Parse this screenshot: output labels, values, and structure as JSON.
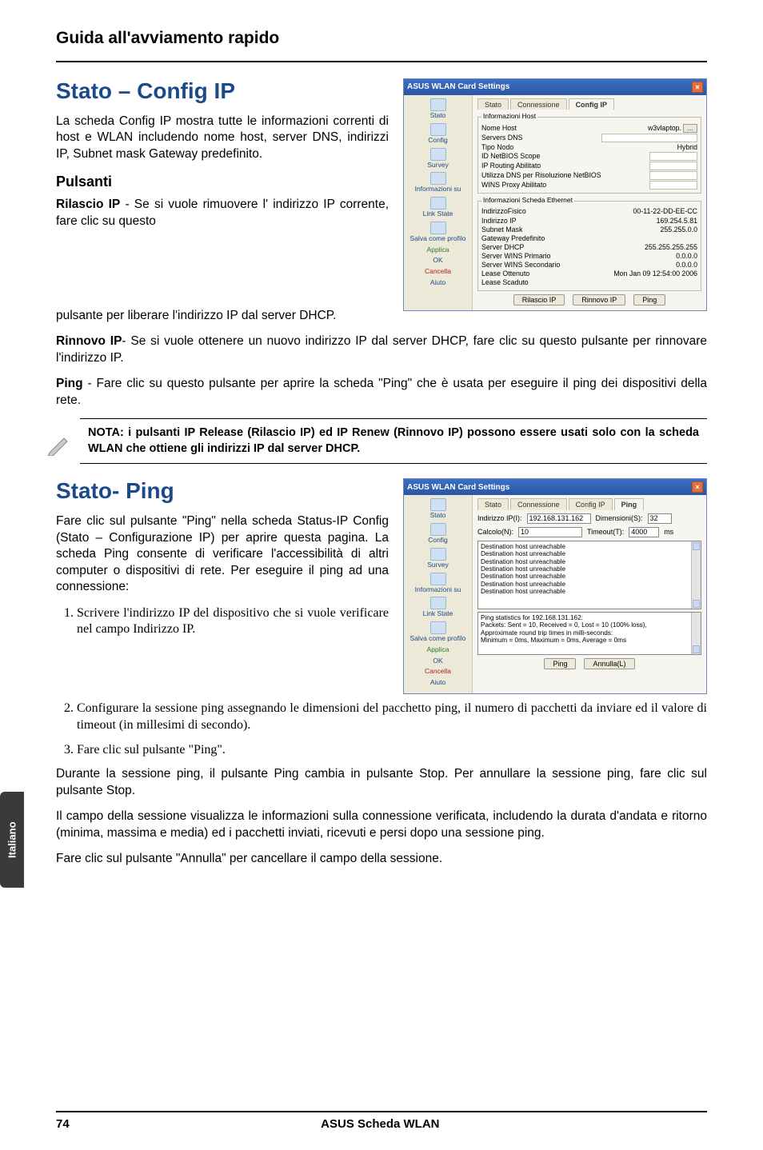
{
  "header": {
    "title": "Guida all'avviamento rapido"
  },
  "sidetab": {
    "label": "Italiano"
  },
  "footer": {
    "page": "74",
    "product": "ASUS Scheda WLAN"
  },
  "section1": {
    "title": "Stato – Config IP",
    "intro": "La scheda Config IP mostra tutte le informazioni correnti di host e WLAN includendo nome host, server DNS, indirizzi IP, Subnet mask Gateway predefinito.",
    "subhead": "Pulsanti",
    "rilascio_runin": "Rilascio IP",
    "rilascio_text": " - Se si vuole rimuovere l' indirizzo IP corrente, fare clic su questo pulsante per liberare l'indirizzo IP dal server DHCP.",
    "rinnovo_runin": "Rinnovo IP",
    "rinnovo_text": "- Se si vuole ottenere un nuovo indirizzo IP dal server DHCP, fare clic su questo pulsante per rinnovare l'indirizzo IP.",
    "ping_runin": "Ping",
    "ping_text": " - Fare clic su questo pulsante per aprire la scheda \"Ping\" che è usata per eseguire il ping dei dispositivi della rete.",
    "note": "NOTA: i pulsanti IP Release (Rilascio IP) ed IP Renew (Rinnovo IP) possono essere usati solo con la scheda WLAN che ottiene gli indirizzi IP dal server DHCP."
  },
  "section2": {
    "title": "Stato- Ping",
    "intro": "Fare clic sul pulsante \"Ping\" nella scheda Status-IP Config (Stato – Configurazione IP) per aprire questa pagina. La scheda Ping consente di verificare l'accessibilità di altri computer o dispositivi di rete. Per eseguire il ping ad una connessione:",
    "steps": [
      "Scrivere l'indirizzo IP del dispositivo che si vuole verificare nel campo Indirizzo IP.",
      "Configurare la sessione ping assegnando le dimensioni del pacchetto ping, il numero di pacchetti da inviare ed il valore di timeout (in millesimi di secondo).",
      "Fare clic sul pulsante \"Ping\"."
    ],
    "para_stop": "Durante la sessione ping, il pulsante Ping cambia in pulsante Stop. Per annullare la sessione ping, fare clic sul pulsante Stop.",
    "para_session": "Il campo della sessione visualizza le informazioni sulla connessione verificata, includendo la durata d'andata e ritorno (minima, massima e media) ed i pacchetti inviati, ricevuti e persi dopo una sessione ping.",
    "para_annulla": "Fare clic sul pulsante \"Annulla\" per cancellare il campo della sessione."
  },
  "win_common": {
    "title": "ASUS WLAN Card Settings",
    "sidebar": {
      "stato": "Stato",
      "config": "Config",
      "survey": "Survey",
      "info": "Informazioni su",
      "linkstate": "Link State",
      "salva": "Salva come profilo",
      "applica": "Applica",
      "ok": "OK",
      "cancella": "Cancella",
      "aiuto": "Aiuto"
    }
  },
  "win1": {
    "tabs": {
      "stato": "Stato",
      "conn": "Connessione",
      "cfg": "Config IP"
    },
    "grp_host": {
      "legend": "Informazioni Host",
      "nome_host_k": "Nome Host",
      "nome_host_v": "w3vlaptop.",
      "servers_dns_k": "Servers DNS",
      "tipo_nodo_k": "Tipo Nodo",
      "tipo_nodo_v": "Hybrid",
      "netbios_scope_k": "ID NetBIOS Scope",
      "ip_routing_k": "IP Routing Abilitato",
      "dns_netbios_k": "Utilizza DNS per Risoluzione NetBIOS",
      "wins_proxy_k": "WINS Proxy Abilitato"
    },
    "grp_eth": {
      "legend": "Informazioni Scheda Ethernet",
      "mac_k": "IndirizzoFisico",
      "mac_v": "00-11-22-DD-EE-CC",
      "ip_k": "Indirizzo IP",
      "ip_v": "169.254.5.81",
      "subnet_k": "Subnet Mask",
      "subnet_v": "255.255.0.0",
      "gw_k": "Gateway Predefinito",
      "dhcp_k": "Server DHCP",
      "dhcp_v": "255.255.255.255",
      "wins1_k": "Server WINS Primario",
      "wins1_v": "0.0.0.0",
      "wins2_k": "Server WINS Secondario",
      "wins2_v": "0.0.0.0",
      "lease_ob_k": "Lease Ottenuto",
      "lease_ob_v": "Mon Jan 09 12:54:00 2006",
      "lease_sc_k": "Lease Scaduto"
    },
    "buttons": {
      "rilascio": "Rilascio IP",
      "rinnovo": "Rinnovo IP",
      "ping": "Ping"
    }
  },
  "win2": {
    "tabs": {
      "stato": "Stato",
      "conn": "Connessione",
      "cfg": "Config IP",
      "ping": "Ping"
    },
    "fields": {
      "ip_label": "Indirizzo IP(I):",
      "ip_val": "192.168.131.162",
      "dim_label": "Dimensioni(S):",
      "dim_val": "32",
      "calc_label": "Calcolo(N):",
      "calc_val": "10",
      "timeout_label": "Timeout(T):",
      "timeout_val": "4000",
      "ms": "ms"
    },
    "log": [
      "Destination host unreachable",
      "Destination host unreachable",
      "Destination host unreachable",
      "Destination host unreachable",
      "Destination host unreachable",
      "Destination host unreachable",
      "Destination host unreachable",
      "",
      "Ping statistics for 192.168.131.162:",
      "    Packets: Sent = 10, Received = 0, Lost = 10 (100% loss),",
      "Approximate round trip times in milli-seconds:",
      "    Minimum = 0ms, Maximum = 0ms, Average = 0ms"
    ],
    "buttons": {
      "ping": "Ping",
      "annulla": "Annulla(L)"
    }
  }
}
